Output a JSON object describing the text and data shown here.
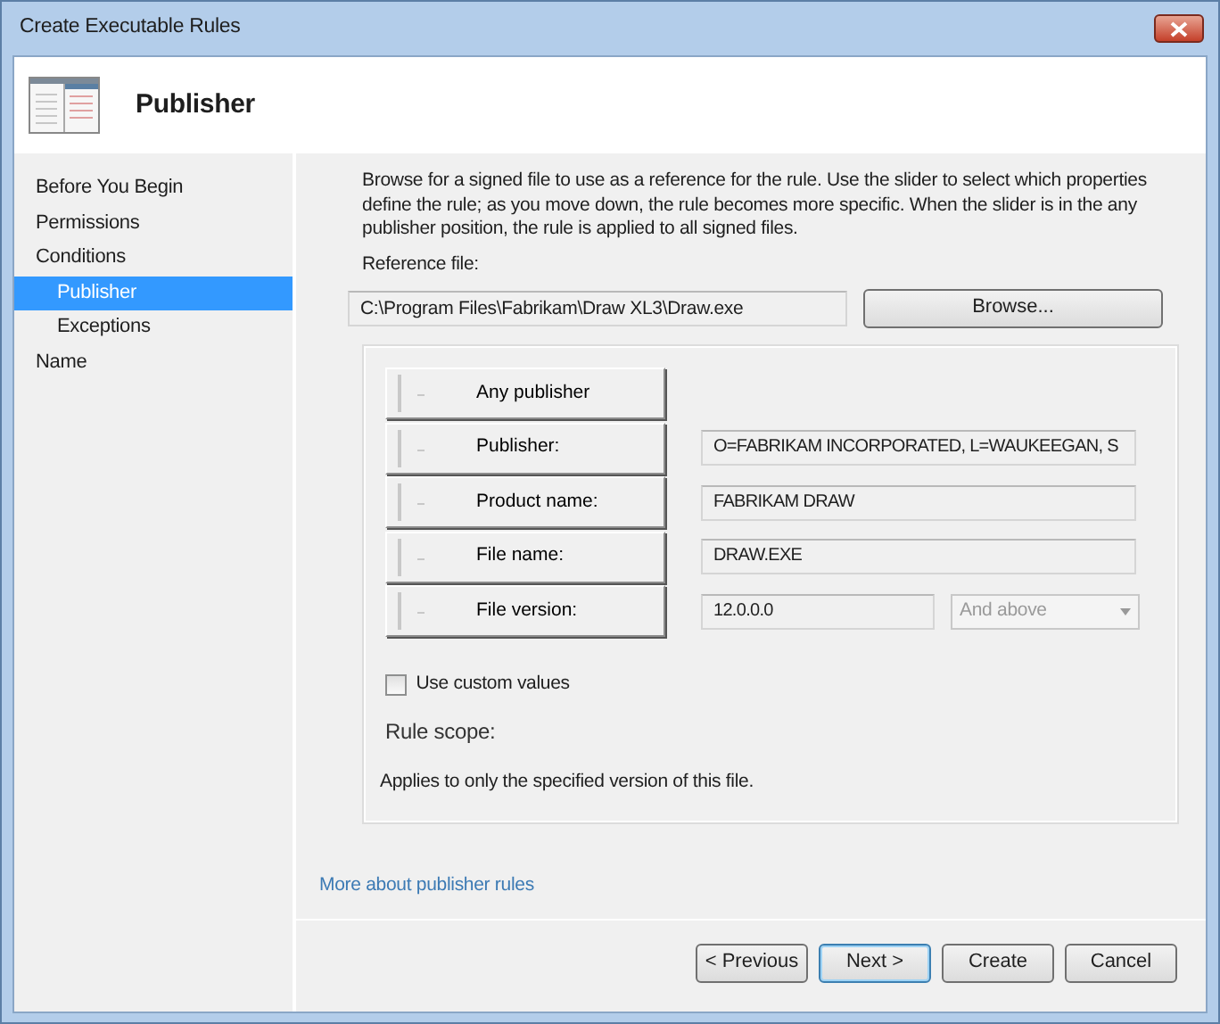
{
  "window": {
    "title": "Create Executable Rules"
  },
  "header": {
    "title": "Publisher"
  },
  "sidebar": {
    "items": [
      {
        "label": "Before You Begin",
        "selected": false
      },
      {
        "label": "Permissions",
        "selected": false
      },
      {
        "label": "Conditions",
        "selected": false,
        "children": [
          {
            "label": "Publisher",
            "selected": true
          },
          {
            "label": "Exceptions",
            "selected": false
          }
        ]
      },
      {
        "label": "Name",
        "selected": false
      }
    ]
  },
  "description": "Browse for a signed file to use as a reference for the rule. Use the slider to select which properties define the rule; as you move down, the rule becomes more specific. When the slider is in the any publisher position, the rule is applied to all signed files.",
  "reference_file": {
    "label": "Reference file:",
    "value": "C:\\Program Files\\Fabrikam\\Draw XL3\\Draw.exe",
    "browse_button": "Browse..."
  },
  "properties": [
    {
      "label": "Any publisher"
    },
    {
      "label": "Publisher:",
      "value": "O=FABRIKAM INCORPORATED, L=WAUKEEGAN, S"
    },
    {
      "label": "Product name:",
      "value": "FABRIKAM DRAW"
    },
    {
      "label": "File name:",
      "value": "DRAW.EXE"
    },
    {
      "label": "File version:",
      "value": "12.0.0.0",
      "dropdown": {
        "value": "And above",
        "disabled": true
      }
    }
  ],
  "custom_values": {
    "label": "Use custom values",
    "checked": false
  },
  "rule_scope": {
    "label": "Rule scope:",
    "text": "Applies to only the specified version of this file."
  },
  "link": "More about publisher rules",
  "buttons": [
    {
      "label": "< Previous",
      "default": false
    },
    {
      "label": "Next >",
      "default": true
    },
    {
      "label": "Create",
      "default": false
    },
    {
      "label": "Cancel",
      "default": false
    }
  ]
}
